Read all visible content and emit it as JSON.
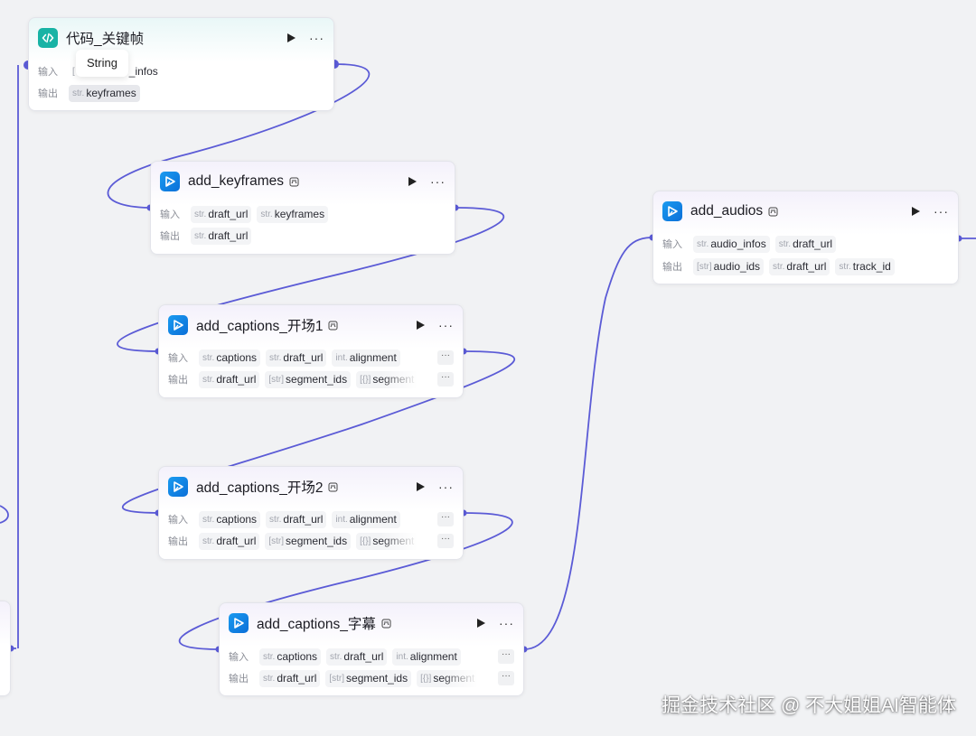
{
  "colors": {
    "edge": "#5b5bd6",
    "canvas": "#f1f2f4",
    "plugin_icon": "#1a9bf0",
    "code_icon": "#18b3a5"
  },
  "labels": {
    "input": "输入",
    "output": "输出",
    "more": "···",
    "overflow": "···"
  },
  "tooltip": {
    "text": "String"
  },
  "watermark": "掘金技术社区 @ 不大姐姐AI智能体",
  "nodes": {
    "code_keyframes": {
      "title": "代码_关键帧",
      "icon": "code-icon",
      "inputs": [
        {
          "type": "[",
          "name": "_infos"
        }
      ],
      "outputs": [
        {
          "type": "str.",
          "name": "keyframes"
        }
      ]
    },
    "add_keyframes": {
      "title": "add_keyframes",
      "icon": "video-plugin-icon",
      "inputs": [
        {
          "type": "str.",
          "name": "draft_url"
        },
        {
          "type": "str.",
          "name": "keyframes"
        }
      ],
      "outputs": [
        {
          "type": "str.",
          "name": "draft_url"
        }
      ]
    },
    "add_captions_1": {
      "title": "add_captions_开场1",
      "icon": "video-plugin-icon",
      "inputs": [
        {
          "type": "str.",
          "name": "captions"
        },
        {
          "type": "str.",
          "name": "draft_url"
        },
        {
          "type": "int.",
          "name": "alignment"
        }
      ],
      "outputs": [
        {
          "type": "str.",
          "name": "draft_url"
        },
        {
          "type": "[str]",
          "name": "segment_ids"
        },
        {
          "type": "[{}]",
          "name": "segment"
        }
      ]
    },
    "add_captions_2": {
      "title": "add_captions_开场2",
      "icon": "video-plugin-icon",
      "inputs": [
        {
          "type": "str.",
          "name": "captions"
        },
        {
          "type": "str.",
          "name": "draft_url"
        },
        {
          "type": "int.",
          "name": "alignment"
        }
      ],
      "outputs": [
        {
          "type": "str.",
          "name": "draft_url"
        },
        {
          "type": "[str]",
          "name": "segment_ids"
        },
        {
          "type": "[{}]",
          "name": "segment"
        }
      ]
    },
    "add_captions_sub": {
      "title": "add_captions_字幕",
      "icon": "video-plugin-icon",
      "inputs": [
        {
          "type": "str.",
          "name": "captions"
        },
        {
          "type": "str.",
          "name": "draft_url"
        },
        {
          "type": "int.",
          "name": "alignment"
        }
      ],
      "outputs": [
        {
          "type": "str.",
          "name": "draft_url"
        },
        {
          "type": "[str]",
          "name": "segment_ids"
        },
        {
          "type": "[{}]",
          "name": "segment"
        }
      ]
    },
    "add_audios": {
      "title": "add_audios",
      "icon": "video-plugin-icon",
      "inputs": [
        {
          "type": "str.",
          "name": "audio_infos"
        },
        {
          "type": "str.",
          "name": "draft_url"
        }
      ],
      "outputs": [
        {
          "type": "[str]",
          "name": "audio_ids"
        },
        {
          "type": "str.",
          "name": "draft_url"
        },
        {
          "type": "str.",
          "name": "track_id"
        }
      ]
    }
  }
}
